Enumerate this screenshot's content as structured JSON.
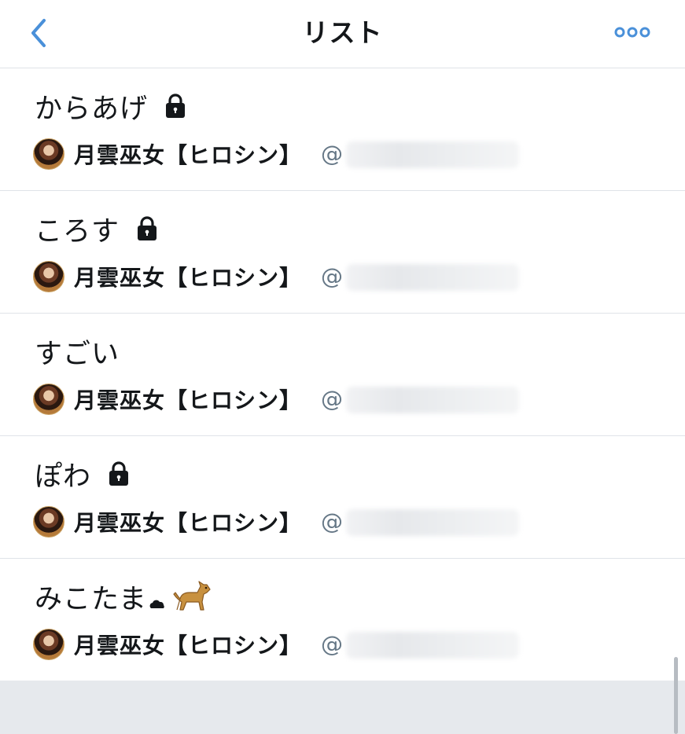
{
  "header": {
    "title": "リスト",
    "back_icon": "chevron-left-icon",
    "more_icon": "more-horizontal-icon",
    "accent_color": "#4a90d9"
  },
  "lists": [
    {
      "name": "からあげ",
      "locked": true,
      "owner_name": "月雲巫女【ヒロシン】",
      "owner_handle_prefix": "@"
    },
    {
      "name": "ころす",
      "locked": true,
      "owner_name": "月雲巫女【ヒロシン】",
      "owner_handle_prefix": "@"
    },
    {
      "name": "すごい",
      "locked": false,
      "owner_name": "月雲巫女【ヒロシン】",
      "owner_handle_prefix": "@"
    },
    {
      "name": "ぽわ",
      "locked": true,
      "owner_name": "月雲巫女【ヒロシン】",
      "owner_handle_prefix": "@"
    },
    {
      "name": "みこたま",
      "locked": false,
      "emoji": [
        "cloud-icon",
        "dog-icon"
      ],
      "owner_name": "月雲巫女【ヒロシン】",
      "owner_handle_prefix": "@"
    }
  ]
}
